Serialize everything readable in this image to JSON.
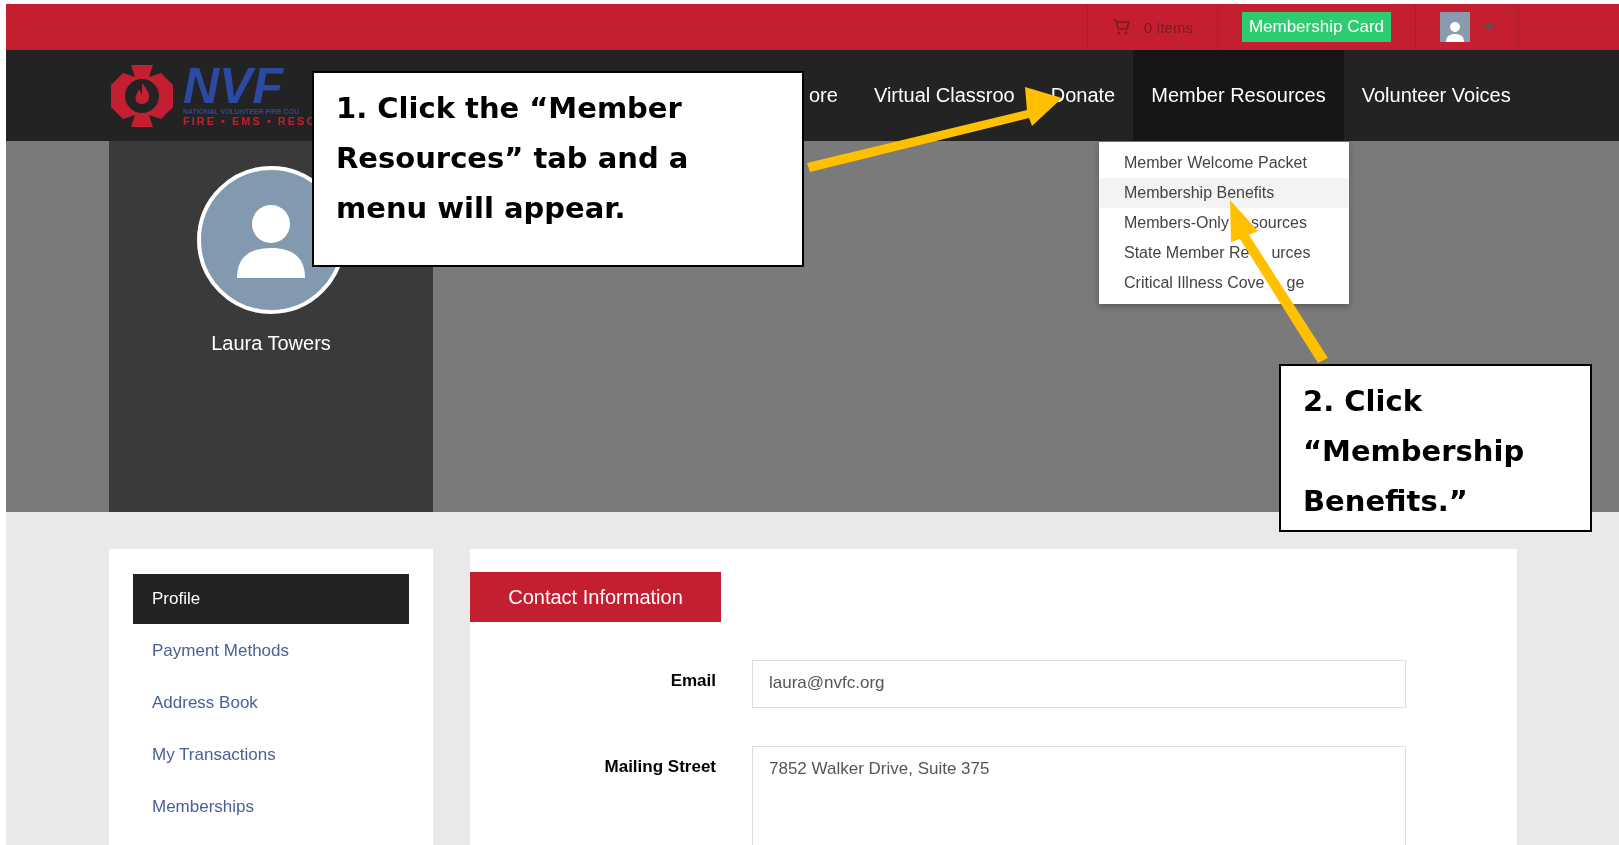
{
  "top_bar": {
    "cart": "0 Items",
    "membership_card": "Membership Card"
  },
  "logo": {
    "mark": "NVF",
    "tagline": "NATIONAL VOLUNTEER FIRE COU",
    "motto": "FIRE • EMS • RESC"
  },
  "nav": [
    {
      "label": "ore",
      "selected": false
    },
    {
      "label": "Virtual Classroo",
      "selected": false
    },
    {
      "label": "Donate",
      "selected": false
    },
    {
      "label": "Member Resources",
      "selected": true
    },
    {
      "label": "Volunteer Voices",
      "selected": false
    }
  ],
  "dropdown": [
    {
      "parts": [
        "Member Welcome Packet"
      ],
      "selected": false
    },
    {
      "parts": [
        "Membership Benefits"
      ],
      "selected": true
    },
    {
      "parts": [
        "Members-Only",
        "sources"
      ],
      "selected": false
    },
    {
      "parts": [
        "State Member Re",
        "urces"
      ],
      "selected": false
    },
    {
      "parts": [
        "Critical Illness Cove",
        "ge"
      ],
      "selected": false
    }
  ],
  "profile": {
    "name": "Laura Towers"
  },
  "sidebar": [
    {
      "label": "Profile",
      "selected": true
    },
    {
      "label": "Payment Methods",
      "selected": false
    },
    {
      "label": "Address Book",
      "selected": false
    },
    {
      "label": "My Transactions",
      "selected": false
    },
    {
      "label": "Memberships",
      "selected": false
    }
  ],
  "section_tab": "Contact Information",
  "fields": [
    {
      "label": "Email",
      "value": "laura@nvfc.org",
      "kind": "input"
    },
    {
      "label": "Mailing Street",
      "value": "7852 Walker Drive, Suite 375",
      "kind": "textarea"
    }
  ],
  "callouts": [
    {
      "lines": [
        "1. Click the “Member",
        "Resources” tab and a",
        "menu will appear."
      ]
    },
    {
      "lines": [
        "2. Click",
        "“Membership",
        "Benefits.”"
      ]
    }
  ]
}
